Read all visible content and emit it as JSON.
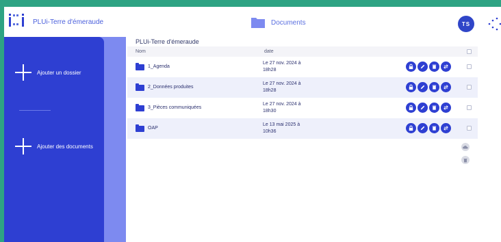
{
  "header": {
    "app_title": "PLUi-Terre d'émeraude",
    "section_title": "Documents",
    "avatar_initials": "TS"
  },
  "sidebar": {
    "add_folder_label": "Ajouter un dossier",
    "add_documents_label": "Ajouter des documents"
  },
  "breadcrumb": "PLUi-Terre d'émeraude",
  "table": {
    "columns": [
      "Nom",
      "date"
    ],
    "rows": [
      {
        "name": "1_Agenda",
        "date_line1": "Le 27 nov. 2024 à",
        "date_line2": "18h28"
      },
      {
        "name": "2_Données produites",
        "date_line1": "Le 27 nov. 2024 à",
        "date_line2": "18h28"
      },
      {
        "name": "3_Pièces communiquées",
        "date_line1": "Le 27 nov. 2024 à",
        "date_line2": "18h30"
      },
      {
        "name": "OAP",
        "date_line1": "Le 13 mai 2025 à",
        "date_line2": "10h36"
      }
    ]
  },
  "colors": {
    "accent": "#2e3fd2",
    "sidebar_back": "#7d8af0",
    "border_green": "#2ea383",
    "row_alt": "#eef0fb"
  },
  "icons": {
    "row_actions": [
      "lock-icon",
      "edit-icon",
      "trash-icon",
      "move-icon"
    ],
    "bulk_actions": [
      "cloud-download-icon",
      "trash-icon"
    ]
  }
}
